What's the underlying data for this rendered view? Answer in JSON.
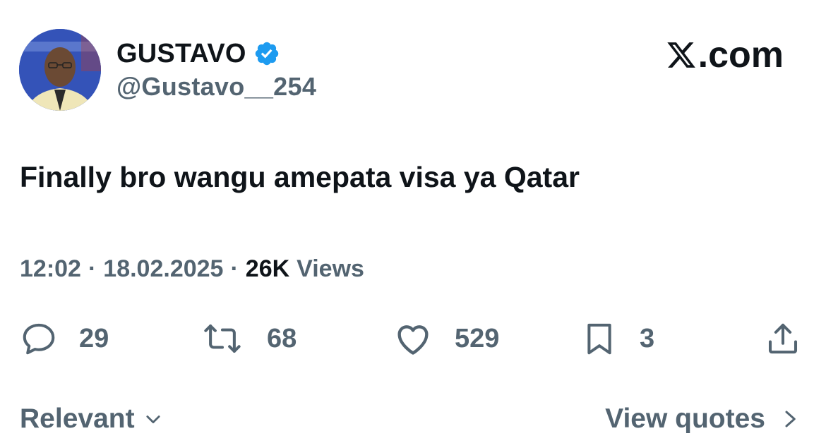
{
  "author": {
    "display_name": "GUSTAVO",
    "handle": "@Gustavo__254",
    "verified": true,
    "verified_color": "#1d9bf0"
  },
  "brand": {
    "label": ".com",
    "icon": "x-logo-icon"
  },
  "tweet": {
    "text": "Finally bro wangu amepata visa ya Qatar"
  },
  "meta": {
    "time": "12:02",
    "separator": "·",
    "date": "18.02.2025",
    "views_count": "26K",
    "views_label": "Views"
  },
  "actions": {
    "replies": "29",
    "reposts": "68",
    "likes": "529",
    "bookmarks": "3"
  },
  "footer": {
    "sort_label": "Relevant",
    "view_quotes_label": "View quotes"
  },
  "colors": {
    "primary_text": "#0f1419",
    "secondary_text": "#536471",
    "accent": "#1d9bf0"
  }
}
